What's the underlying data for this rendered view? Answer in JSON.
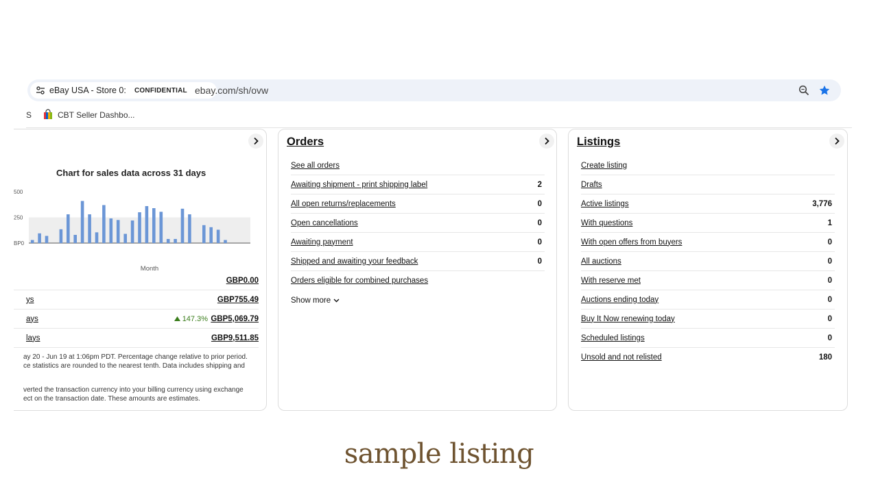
{
  "browser": {
    "site_name": "eBay USA - Store 0:",
    "site_badge": "CONFIDENTIAL",
    "url": "ebay.com/sh/ovw",
    "bookmarks": [
      {
        "label": "S"
      },
      {
        "label": "CBT Seller Dashbo..."
      }
    ],
    "colors": {
      "accent": "#1a73e8",
      "bar_bg": "#eef2f9"
    }
  },
  "sales": {
    "chart_title": "Chart for sales data across 31 days",
    "summary": [
      {
        "label": "",
        "amount": "GBP0.00",
        "change": ""
      },
      {
        "label": "ys",
        "amount": "GBP755.49",
        "change": ""
      },
      {
        "label": "ays",
        "amount": "GBP5,069.79",
        "change": "147.3%"
      },
      {
        "label": "lays",
        "amount": "GBP9,511.85",
        "change": ""
      }
    ],
    "notes": [
      "ay 20 - Jun 19 at 1:06pm PDT. Percentage change relative to prior period.",
      "ce statistics are rounded to the nearest tenth. Data includes shipping and",
      "verted the transaction currency into your billing currency using exchange",
      "ect on the transaction date. These amounts are estimates."
    ]
  },
  "chart_data": {
    "type": "bar",
    "title": "Chart for sales data across 31 days",
    "xlabel": "Month",
    "ylabel": "",
    "y_ticks": [
      "500",
      "250",
      "BP0"
    ],
    "ylim": [
      0,
      560
    ],
    "values": [
      30,
      95,
      70,
      0,
      135,
      280,
      80,
      410,
      280,
      105,
      370,
      240,
      225,
      90,
      220,
      300,
      360,
      340,
      305,
      40,
      40,
      335,
      280,
      0,
      175,
      155,
      130,
      30,
      0,
      0,
      0
    ],
    "bar_color": "#6b96d6",
    "band_color": "#eeeeee"
  },
  "orders": {
    "title": "Orders",
    "items": [
      {
        "label": "See all orders",
        "count": ""
      },
      {
        "label": "Awaiting shipment - print shipping label",
        "count": "2"
      },
      {
        "label": "All open returns/replacements",
        "count": "0"
      },
      {
        "label": "Open cancellations",
        "count": "0"
      },
      {
        "label": "Awaiting payment",
        "count": "0"
      },
      {
        "label": "Shipped and awaiting your feedback",
        "count": "0"
      },
      {
        "label": "Orders eligible for combined purchases",
        "count": ""
      }
    ],
    "show_more": "Show more"
  },
  "listings": {
    "title": "Listings",
    "items": [
      {
        "label": "Create listing",
        "count": ""
      },
      {
        "label": "Drafts",
        "count": ""
      },
      {
        "label": "Active listings",
        "count": "3,776"
      },
      {
        "label": "With questions",
        "count": "1"
      },
      {
        "label": "With open offers from buyers",
        "count": "0"
      },
      {
        "label": "All auctions",
        "count": "0"
      },
      {
        "label": "With reserve met",
        "count": "0"
      },
      {
        "label": "Auctions ending today",
        "count": "0"
      },
      {
        "label": "Buy It Now renewing today",
        "count": "0"
      },
      {
        "label": "Scheduled listings",
        "count": "0"
      },
      {
        "label": "Unsold and not relisted",
        "count": "180"
      }
    ]
  },
  "caption": "sample listing"
}
